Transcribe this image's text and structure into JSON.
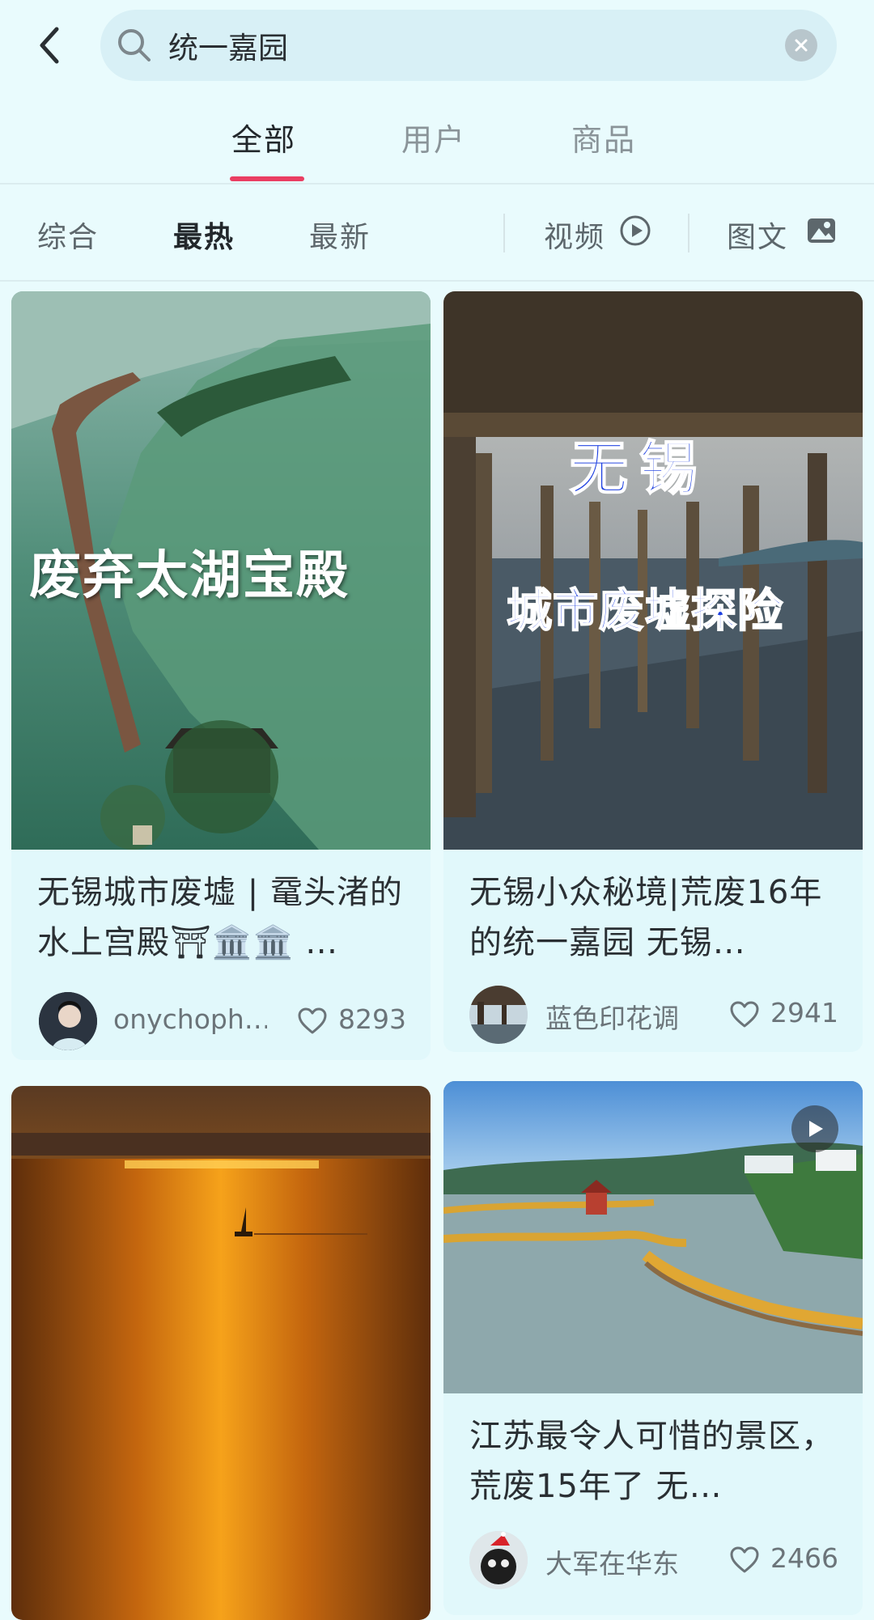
{
  "search": {
    "query": "统一嘉园"
  },
  "tabs": [
    {
      "label": "全部"
    },
    {
      "label": "用户"
    },
    {
      "label": "商品"
    }
  ],
  "filters": {
    "sort": [
      "综合",
      "最热",
      "最新"
    ],
    "video": "视频",
    "image_text": "图文"
  },
  "colors": {
    "accent": "#ea3e62",
    "background": "#e9fbfd"
  },
  "posts": [
    {
      "cover_text": "废弃太湖宝殿",
      "title": "无锡城市废墟 | 鼋头渚的水上宫殿⛩🏛️🏛️ …",
      "author": "onychoph…",
      "likes": "8293"
    },
    {
      "cover_text_1": "无锡",
      "cover_text_2": "城市废墟探险",
      "title": "无锡小众秘境|荒废16年的统一嘉园 无锡…",
      "author": "蓝色印花调",
      "likes": "2941"
    },
    {
      "title": ""
    },
    {
      "title": "江苏最令人可惜的景区，荒废15年了 无…",
      "author": "大军在华东",
      "likes": "2466"
    }
  ]
}
